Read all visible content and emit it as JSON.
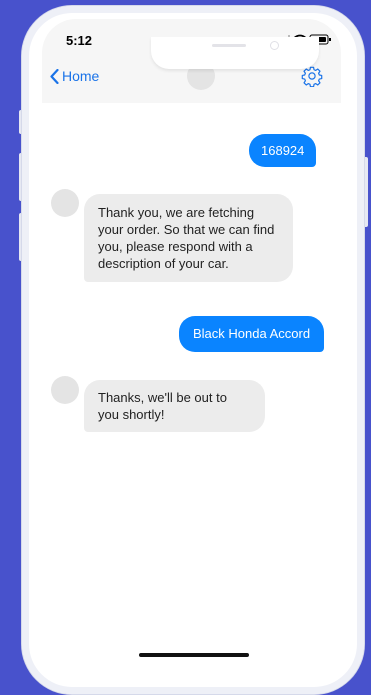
{
  "status_bar": {
    "time": "5:12"
  },
  "nav": {
    "back_label": "Home",
    "back_icon": "chevron-left-icon",
    "settings_icon": "gear-icon"
  },
  "messages": [
    {
      "from": "user",
      "text": "168924"
    },
    {
      "from": "bot",
      "text": "Thank you, we are fetching your order. So that we can find you, please respond with a description of your car."
    },
    {
      "from": "user",
      "text": "Black Honda Accord"
    },
    {
      "from": "bot",
      "text": "Thanks, we'll be out to you shortly!"
    }
  ],
  "colors": {
    "background": "#4852cc",
    "accent": "#0a84ff",
    "incoming_bubble": "#ececec"
  }
}
